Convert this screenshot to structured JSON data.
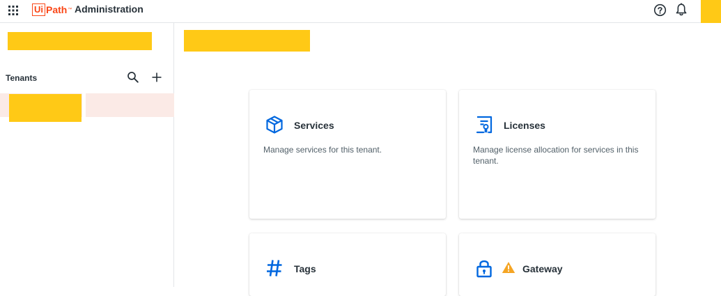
{
  "header": {
    "logo_boxed": "Ui",
    "logo_text": "Path",
    "logo_tm": "™",
    "app_title": "Administration",
    "icons": [
      "apps-grid-icon",
      "help-icon",
      "bell-icon"
    ]
  },
  "sidebar": {
    "tenants_label": "Tenants"
  },
  "cards": [
    {
      "title": "Services",
      "description": "Manage services for this tenant.",
      "icon": "cube-icon"
    },
    {
      "title": "Licenses",
      "description": "Manage license allocation for services in this tenant.",
      "icon": "certificate-icon"
    },
    {
      "title": "Tags",
      "description": "",
      "icon": "hash-icon"
    },
    {
      "title": "Gateway",
      "description": "",
      "icon": "lock-icon",
      "badge": "warning-icon"
    }
  ],
  "colors": {
    "brand": "#fa4616",
    "accent": "#0067df",
    "selected_row": "#fbeae6",
    "warning": "#f5a524",
    "redaction": "#ffc916"
  }
}
